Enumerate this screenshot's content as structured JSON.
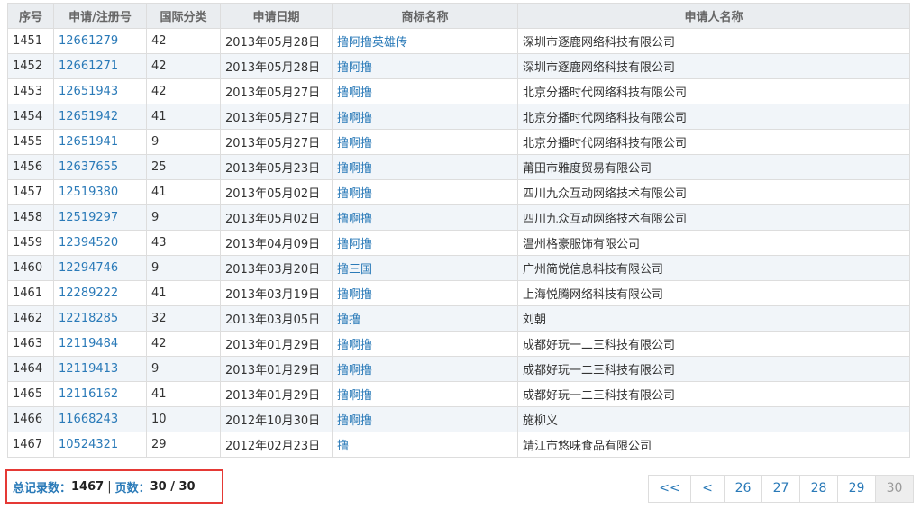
{
  "table": {
    "headers": [
      "序号",
      "申请/注册号",
      "国际分类",
      "申请日期",
      "商标名称",
      "申请人名称"
    ],
    "rows": [
      [
        "1451",
        "12661279",
        "42",
        "2013年05月28日",
        "撸阿撸英雄传",
        "深圳市逐鹿网络科技有限公司"
      ],
      [
        "1452",
        "12661271",
        "42",
        "2013年05月28日",
        "撸阿撸",
        "深圳市逐鹿网络科技有限公司"
      ],
      [
        "1453",
        "12651943",
        "42",
        "2013年05月27日",
        "撸啊撸",
        "北京分播时代网络科技有限公司"
      ],
      [
        "1454",
        "12651942",
        "41",
        "2013年05月27日",
        "撸啊撸",
        "北京分播时代网络科技有限公司"
      ],
      [
        "1455",
        "12651941",
        "9",
        "2013年05月27日",
        "撸啊撸",
        "北京分播时代网络科技有限公司"
      ],
      [
        "1456",
        "12637655",
        "25",
        "2013年05月23日",
        "撸啊撸",
        "莆田市雅度贸易有限公司"
      ],
      [
        "1457",
        "12519380",
        "41",
        "2013年05月02日",
        "撸啊撸",
        "四川九众互动网络技术有限公司"
      ],
      [
        "1458",
        "12519297",
        "9",
        "2013年05月02日",
        "撸啊撸",
        "四川九众互动网络技术有限公司"
      ],
      [
        "1459",
        "12394520",
        "43",
        "2013年04月09日",
        "撸阿撸",
        "温州格豪服饰有限公司"
      ],
      [
        "1460",
        "12294746",
        "9",
        "2013年03月20日",
        "撸三国",
        "广州简悦信息科技有限公司"
      ],
      [
        "1461",
        "12289222",
        "41",
        "2013年03月19日",
        "撸啊撸",
        "上海悦腾网络科技有限公司"
      ],
      [
        "1462",
        "12218285",
        "32",
        "2013年03月05日",
        "撸撸",
        "刘朝"
      ],
      [
        "1463",
        "12119484",
        "42",
        "2013年01月29日",
        "撸啊撸",
        "成都好玩一二三科技有限公司"
      ],
      [
        "1464",
        "12119413",
        "9",
        "2013年01月29日",
        "撸啊撸",
        "成都好玩一二三科技有限公司"
      ],
      [
        "1465",
        "12116162",
        "41",
        "2013年01月29日",
        "撸啊撸",
        "成都好玩一二三科技有限公司"
      ],
      [
        "1466",
        "11668243",
        "10",
        "2012年10月30日",
        "撸啊撸",
        "施柳义"
      ],
      [
        "1467",
        "10524321",
        "29",
        "2012年02月23日",
        "撸",
        "靖江市悠味食品有限公司"
      ]
    ]
  },
  "summary": {
    "total_label": "总记录数：",
    "total_value": "1467",
    "separator": "|",
    "pages_label": "页数：",
    "pages_value": "30 / 30"
  },
  "pagination": {
    "items": [
      "<<",
      "<",
      "26",
      "27",
      "28",
      "29",
      "30"
    ],
    "current": "30"
  },
  "colors": {
    "link": "#2a7ab8",
    "header_bg": "#eaedf0",
    "stripe_bg": "#f1f5f9",
    "highlight_border": "#e53935"
  }
}
